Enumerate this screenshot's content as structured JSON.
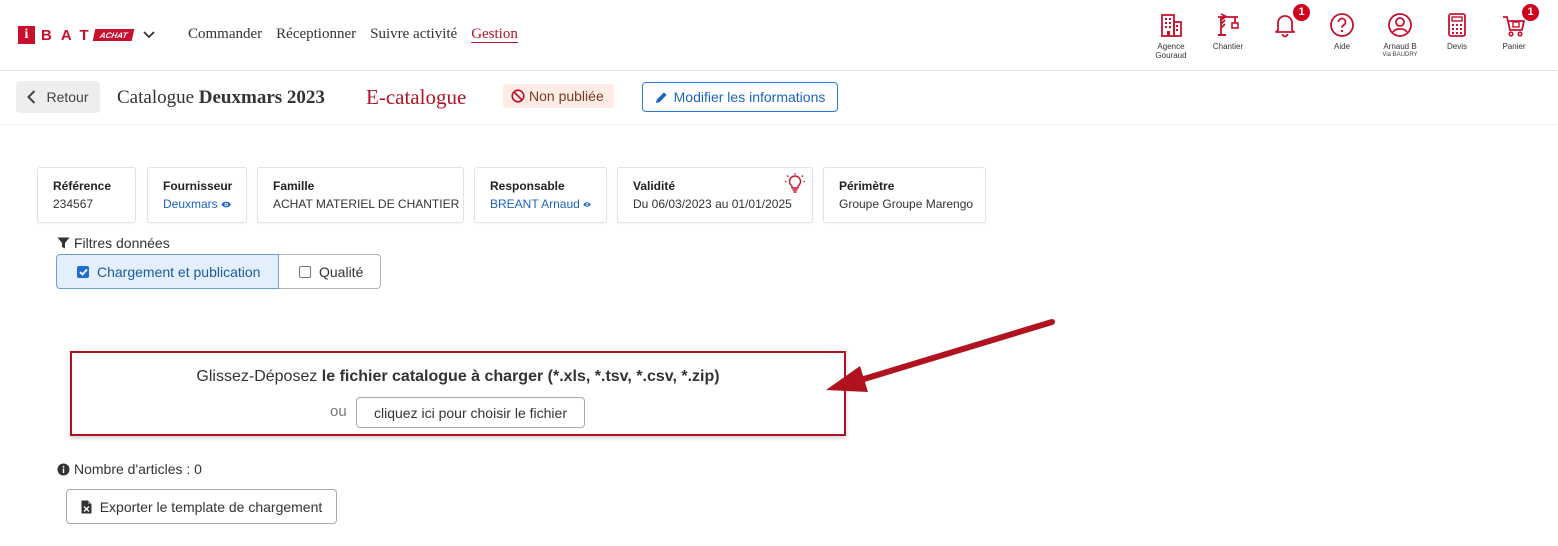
{
  "brand": {
    "letters": "BAT",
    "badge": "ACHAT",
    "icon_letter": "i",
    "accent": "#c8102e"
  },
  "nav": {
    "items": [
      {
        "label": "Commander"
      },
      {
        "label": "Réceptionner"
      },
      {
        "label": "Suivre activité"
      },
      {
        "label": "Gestion"
      }
    ],
    "active": "Gestion"
  },
  "tools": {
    "agence": {
      "label": "Agence",
      "sub": "Gouraud",
      "icon": "building-icon"
    },
    "chantier": {
      "label": "Chantier",
      "icon": "crane-icon"
    },
    "notifications": {
      "count": "1",
      "icon": "bell-icon"
    },
    "aide": {
      "label": "Aide",
      "icon": "help-icon"
    },
    "user": {
      "label": "Arnaud B",
      "sub": "Via BAUDRY",
      "icon": "user-icon"
    },
    "devis": {
      "label": "Devis",
      "icon": "calculator-icon"
    },
    "panier": {
      "label": "Panier",
      "count": "1",
      "icon": "cart-icon"
    }
  },
  "header": {
    "back_label": "Retour",
    "title_prefix": "Catalogue",
    "title_name": "Deuxmars 2023",
    "catalog_type": "E-catalogue",
    "status": "Non publiée",
    "edit_label": "Modifier les informations"
  },
  "cards": {
    "reference": {
      "label": "Référence",
      "value": "234567"
    },
    "fournisseur": {
      "label": "Fournisseur",
      "value": "Deuxmars"
    },
    "famille": {
      "label": "Famille",
      "value": "ACHAT MATERIEL DE CHANTIER"
    },
    "responsable": {
      "label": "Responsable",
      "value": "BREANT Arnaud"
    },
    "validite": {
      "label": "Validité",
      "value": "Du 06/03/2023 au 01/01/2025"
    },
    "perimetre": {
      "label": "Périmètre",
      "value": "Groupe Groupe Marengo"
    }
  },
  "filters": {
    "title": "Filtres données",
    "options": [
      {
        "label": "Chargement et publication",
        "checked": true
      },
      {
        "label": "Qualité",
        "checked": false
      }
    ]
  },
  "dropzone": {
    "prefix": "Glissez-Déposez ",
    "bold": "le fichier catalogue à charger (*.xls, *.tsv, *.csv, *.zip)",
    "or": "ou",
    "button": "cliquez ici pour choisir le fichier"
  },
  "footer": {
    "count_label": "Nombre d'articles : 0",
    "export_label": "Exporter le template de chargement"
  }
}
